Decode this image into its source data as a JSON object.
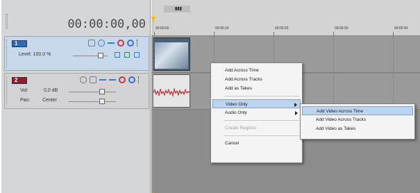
{
  "timecode": "00:00:00,00",
  "ruler": {
    "loop_label": "▮▮▮",
    "ticks": [
      "00:00:00",
      "00:00:10",
      "00:00:20",
      "00:00:30",
      "00:00:40"
    ]
  },
  "video_track": {
    "number": "1",
    "level_label": "Level: 100,0 %"
  },
  "audio_track": {
    "number": "2",
    "vol_label": "Vol:",
    "vol_value": "0,0 dB",
    "pan_label": "Pan:",
    "pan_value": "Center"
  },
  "context_menu": {
    "items": [
      "Add Across Time",
      "Add Across Tracks",
      "Add as Takes",
      "Video Only",
      "Audio Only",
      "Create Regions",
      "Cancel"
    ]
  },
  "submenu": {
    "items": [
      "Add Video Across Time",
      "Add Video Across Tracks",
      "Add Video as Takes"
    ]
  },
  "colors": {
    "video_track": "#2e68b8",
    "audio_track": "#8d1f28",
    "menu_highlight": "#bcd4f0",
    "cursor": "#f0c000"
  }
}
